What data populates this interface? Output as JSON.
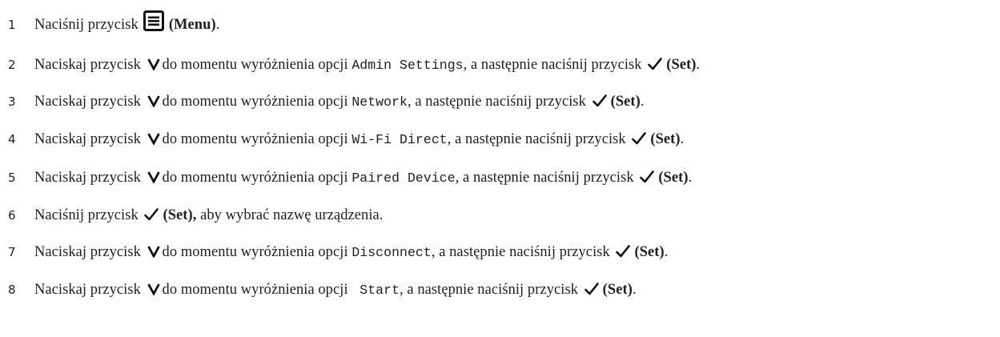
{
  "steps": [
    {
      "number": "1",
      "parts": [
        {
          "t": "text",
          "v": "Naciśnij przycisk"
        },
        {
          "t": "icon",
          "icon": "menu-icon"
        },
        {
          "t": "bold",
          "v": "(Menu)"
        },
        {
          "t": "text",
          "v": "."
        }
      ]
    },
    {
      "number": "2",
      "parts": [
        {
          "t": "text",
          "v": "Naciskaj przycisk "
        },
        {
          "t": "icon",
          "icon": "chevron-down-icon"
        },
        {
          "t": "text",
          "v": "do momentu wyróżnienia opcji "
        },
        {
          "t": "mono",
          "v": "Admin Settings"
        },
        {
          "t": "text",
          "v": ", a następnie naciśnij przycisk "
        },
        {
          "t": "icon",
          "icon": "check-icon"
        },
        {
          "t": "bold",
          "v": "(Set)"
        },
        {
          "t": "text",
          "v": "."
        }
      ]
    },
    {
      "number": "3",
      "parts": [
        {
          "t": "text",
          "v": "Naciskaj przycisk "
        },
        {
          "t": "icon",
          "icon": "chevron-down-icon"
        },
        {
          "t": "text",
          "v": "do momentu wyróżnienia opcji "
        },
        {
          "t": "mono",
          "v": "Network"
        },
        {
          "t": "text",
          "v": ", a następnie naciśnij przycisk "
        },
        {
          "t": "icon",
          "icon": "check-icon"
        },
        {
          "t": "bold",
          "v": "(Set)"
        },
        {
          "t": "text",
          "v": "."
        }
      ]
    },
    {
      "number": "4",
      "parts": [
        {
          "t": "text",
          "v": "Naciskaj przycisk "
        },
        {
          "t": "icon",
          "icon": "chevron-down-icon"
        },
        {
          "t": "text",
          "v": "do momentu wyróżnienia opcji "
        },
        {
          "t": "mono",
          "v": "Wi-Fi Direct"
        },
        {
          "t": "text",
          "v": ", a następnie naciśnij przycisk "
        },
        {
          "t": "icon",
          "icon": "check-icon"
        },
        {
          "t": "bold",
          "v": "(Set)"
        },
        {
          "t": "text",
          "v": "."
        }
      ]
    },
    {
      "number": "5",
      "parts": [
        {
          "t": "text",
          "v": "Naciskaj przycisk "
        },
        {
          "t": "icon",
          "icon": "chevron-down-icon"
        },
        {
          "t": "text",
          "v": "do momentu wyróżnienia opcji "
        },
        {
          "t": "mono",
          "v": "Paired Device"
        },
        {
          "t": "text",
          "v": ", a następnie naciśnij przycisk "
        },
        {
          "t": "icon",
          "icon": "check-icon"
        },
        {
          "t": "bold",
          "v": "(Set)"
        },
        {
          "t": "text",
          "v": "."
        }
      ]
    },
    {
      "number": "6",
      "parts": [
        {
          "t": "text",
          "v": "Naciśnij przycisk "
        },
        {
          "t": "icon",
          "icon": "check-icon"
        },
        {
          "t": "bold",
          "v": "(Set),"
        },
        {
          "t": "text",
          "v": " aby wybrać nazwę urządzenia."
        }
      ]
    },
    {
      "number": "7",
      "parts": [
        {
          "t": "text",
          "v": "Naciskaj przycisk "
        },
        {
          "t": "icon",
          "icon": "chevron-down-icon"
        },
        {
          "t": "text",
          "v": "do momentu wyróżnienia opcji "
        },
        {
          "t": "mono",
          "v": "Disconnect"
        },
        {
          "t": "text",
          "v": ", a następnie naciśnij przycisk "
        },
        {
          "t": "icon",
          "icon": "check-icon"
        },
        {
          "t": "bold",
          "v": "(Set)"
        },
        {
          "t": "text",
          "v": "."
        }
      ]
    },
    {
      "number": "8",
      "parts": [
        {
          "t": "text",
          "v": "Naciskaj przycisk "
        },
        {
          "t": "icon",
          "icon": "chevron-down-icon"
        },
        {
          "t": "text",
          "v": "do momentu wyróżnienia opcji "
        },
        {
          "t": "mono",
          "v": " Start"
        },
        {
          "t": "text",
          "v": ", a następnie naciśnij przycisk "
        },
        {
          "t": "icon",
          "icon": "check-icon"
        },
        {
          "t": "bold",
          "v": "(Set)"
        },
        {
          "t": "text",
          "v": "."
        }
      ]
    }
  ]
}
